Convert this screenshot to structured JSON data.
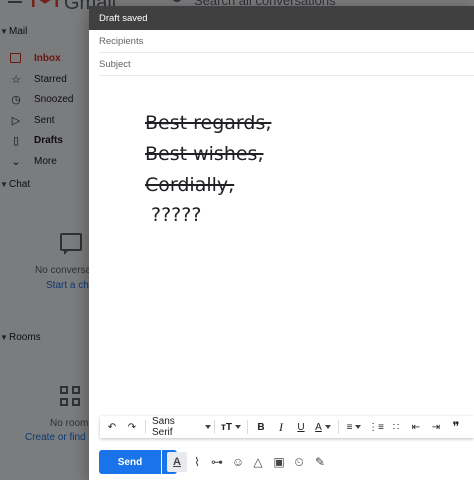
{
  "background": {
    "app_name": "Gmail",
    "search_placeholder": "Search all conversations",
    "sections": {
      "mail": "Mail",
      "chat": "Chat",
      "rooms": "Rooms"
    },
    "nav_items": [
      {
        "label": "Inbox",
        "icon": "inbox-icon"
      },
      {
        "label": "Starred",
        "icon": "star-icon"
      },
      {
        "label": "Snoozed",
        "icon": "clock-icon"
      },
      {
        "label": "Sent",
        "icon": "send-icon"
      },
      {
        "label": "Drafts",
        "icon": "draft-icon"
      },
      {
        "label": "More",
        "icon": "chevron-down-icon"
      }
    ],
    "chat_empty": "No conversations",
    "chat_link": "Start a chat",
    "rooms_empty": "No rooms yet",
    "rooms_link": "Create or find a room"
  },
  "compose": {
    "status": "Draft saved",
    "recipients_placeholder": "Recipients",
    "subject_placeholder": "Subject",
    "body_lines": [
      {
        "text": "Best regards,",
        "struck": true
      },
      {
        "text": "Best wishes,",
        "struck": true
      },
      {
        "text": "Cordially,",
        "struck": true
      },
      {
        "text": "?????",
        "struck": false
      }
    ],
    "toolbar": {
      "font_family": "Sans Serif",
      "font_size_symbol": "тT",
      "bold": "B",
      "italic": "I",
      "underline": "U",
      "text_color": "A",
      "quote": "❞"
    },
    "send_label": "Send"
  },
  "colors": {
    "accent": "#1a73e8",
    "header_bg": "#404040",
    "inbox_red": "#d93025"
  }
}
